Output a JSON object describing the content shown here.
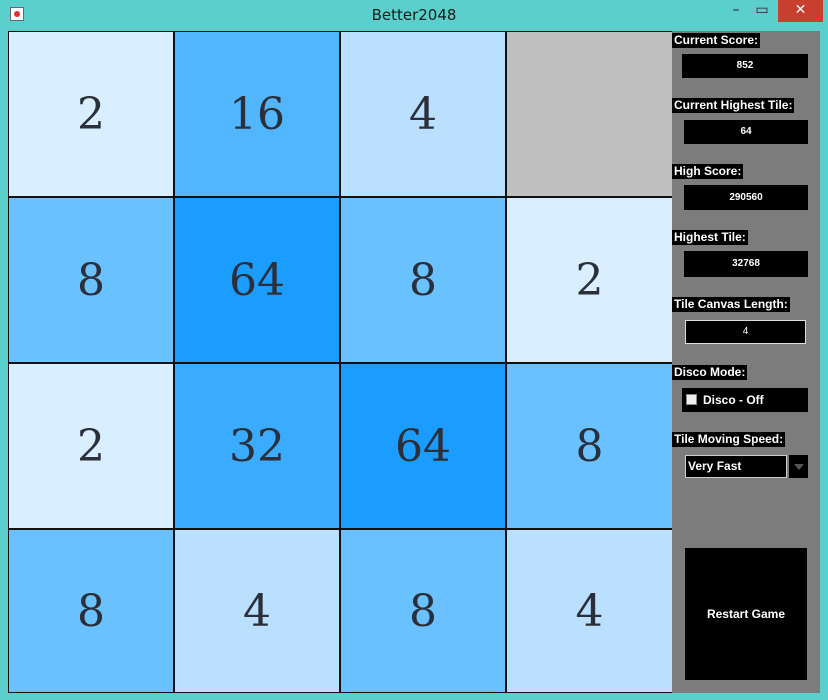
{
  "window": {
    "title": "Better2048",
    "minimize": "–",
    "maximize": "▭",
    "close": "✕"
  },
  "board": {
    "size": 4,
    "rows": [
      [
        {
          "value": "2",
          "color": "#d9eeff"
        },
        {
          "value": "16",
          "color": "#52b6ff"
        },
        {
          "value": "4",
          "color": "#badfff"
        },
        {
          "value": "",
          "color": "#c0c0c0"
        }
      ],
      [
        {
          "value": "8",
          "color": "#6ac1ff"
        },
        {
          "value": "64",
          "color": "#1b9dff"
        },
        {
          "value": "8",
          "color": "#6ac1ff"
        },
        {
          "value": "2",
          "color": "#d9eeff"
        }
      ],
      [
        {
          "value": "2",
          "color": "#d9eeff"
        },
        {
          "value": "32",
          "color": "#3aabff"
        },
        {
          "value": "64",
          "color": "#1b9dff"
        },
        {
          "value": "8",
          "color": "#6ac1ff"
        }
      ],
      [
        {
          "value": "8",
          "color": "#6ac1ff"
        },
        {
          "value": "4",
          "color": "#badfff"
        },
        {
          "value": "8",
          "color": "#6ac1ff"
        },
        {
          "value": "4",
          "color": "#badfff"
        }
      ]
    ]
  },
  "panel": {
    "current_score_label": "Current Score:",
    "current_score": "852",
    "current_highest_tile_label": "Current Highest Tile:",
    "current_highest_tile": "64",
    "high_score_label": "High Score:",
    "high_score": "290560",
    "highest_tile_label": "Highest Tile:",
    "highest_tile": "32768",
    "canvas_length_label": "Tile Canvas Length:",
    "canvas_length": "4",
    "disco_label": "Disco Mode:",
    "disco_toggle": "Disco - Off",
    "speed_label": "Tile Moving Speed:",
    "speed_value": "Very Fast",
    "restart": "Restart Game"
  }
}
